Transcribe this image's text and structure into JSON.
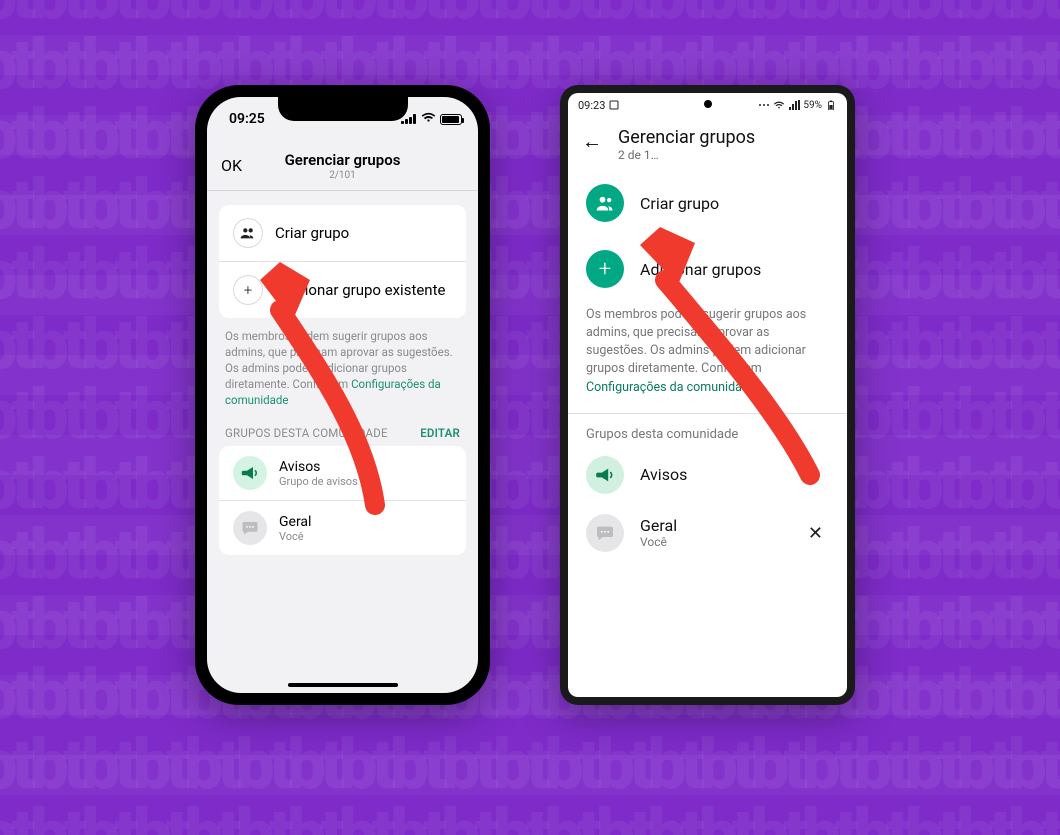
{
  "bg_pattern_glyph": "tbtbtbtbtbtbtbtbtbtbtbtbtbtbtbtbtbtbtbtbtbtbtbtbtbtbtbtbtbtbtbtb",
  "ios": {
    "status_time": "09:25",
    "header_ok": "OK",
    "header_title": "Gerenciar grupos",
    "header_sub": "2/101",
    "create_group_label": "Criar grupo",
    "add_existing_label": "Adicionar grupo existente",
    "info_text_1": "Os membros podem sugerir grupos aos admins, que precisam aprovar as sugestões. Os admins podem adicionar grupos diretamente. Confira em ",
    "info_link": "Configurações da comunidade",
    "section_title": "GRUPOS DESTA COMUNIDADE",
    "section_edit": "EDITAR",
    "groups": [
      {
        "name": "Avisos",
        "sub": "Grupo de avisos",
        "avatar": "green",
        "icon": "megaphone"
      },
      {
        "name": "Geral",
        "sub": "Você",
        "avatar": "grey",
        "icon": "chat"
      }
    ]
  },
  "android": {
    "status_time": "09:23",
    "status_battery": "59%",
    "header_title": "Gerenciar grupos",
    "header_sub": "2 de 1…",
    "create_group_label": "Criar grupo",
    "add_groups_label": "Adicionar grupos",
    "info_text_1": "Os membros podem sugerir grupos aos admins, que precisam aprovar as sugestões. Os admins podem adicionar grupos diretamente. Confira em ",
    "info_link": "Configurações da comunidade",
    "section_title": "Grupos desta comunidade",
    "groups": [
      {
        "name": "Avisos",
        "sub": "",
        "avatar": "green",
        "icon": "megaphone",
        "closable": false
      },
      {
        "name": "Geral",
        "sub": "Você",
        "avatar": "grey",
        "icon": "chat",
        "closable": true
      }
    ]
  },
  "colors": {
    "accent_green": "#00a884",
    "link_teal": "#0a7a62",
    "arrow_red": "#ef3a2d"
  }
}
